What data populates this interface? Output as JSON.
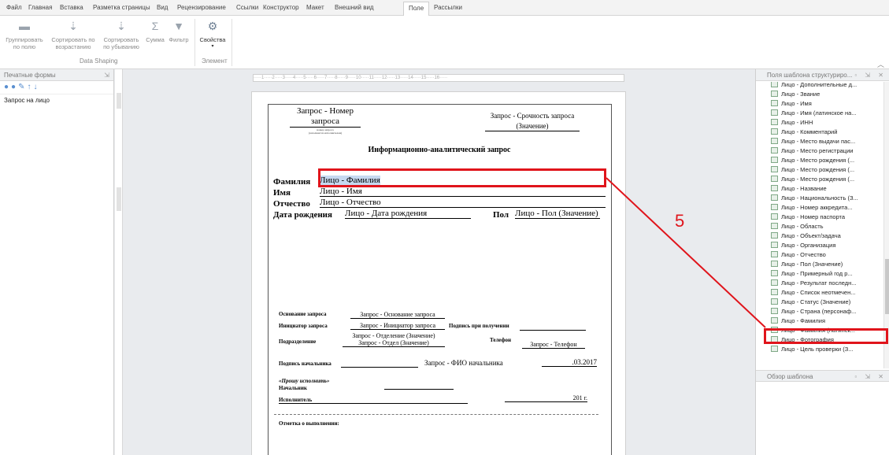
{
  "ribbon_tabs": [
    "Файл",
    "Главная",
    "Вставка",
    "Разметка страницы",
    "Вид",
    "Рецензирование",
    "Ссылки",
    "Конструктор",
    "Макет",
    "Внешний вид",
    "Поле",
    "Рассылки"
  ],
  "active_tab": "Поле",
  "ribbon": {
    "group_by_field": "Группировать\nпо полю",
    "sort_asc": "Сортировать по\nвозрастанию",
    "sort_desc": "Сортировать\nпо убыванию",
    "sum": "Сумма",
    "filter": "Фильтр",
    "properties": "Свойства",
    "group_data_shaping": "Data Shaping",
    "group_element": "Элемент"
  },
  "left_panel": {
    "title": "Печатные формы",
    "items": [
      "Запрос на лицо"
    ]
  },
  "right_panel": {
    "title": "Поля шаблона структуриро...",
    "bottom_title": "Обзор шаблона",
    "fields": [
      "Лицо - Дополнительные д...",
      "Лицо - Звание",
      "Лицо - Имя",
      "Лицо - Имя (латинское на...",
      "Лицо - ИНН",
      "Лицо - Комментарий",
      "Лицо - Место выдачи пас...",
      "Лицо - Место регистрации",
      "Лицо - Место рождения (...",
      "Лицо - Место рождения (...",
      "Лицо - Место рождения (...",
      "Лицо - Название",
      "Лицо - Национальность (З...",
      "Лицо - Номер аккредита...",
      "Лицо - Номер паспорта",
      "Лицо - Область",
      "Лицо - Объект/задача",
      "Лицо - Организация",
      "Лицо - Отчество",
      "Лицо - Пол (Значение)",
      "Лицо - Примерный год р...",
      "Лицо - Результат последн...",
      "Лицо - Список неотмечен...",
      "Лицо - Статус (Значение)",
      "Лицо - Страна (персонаф...",
      "Лицо - Фамилия",
      "Лицо - Фамилия (латинск...",
      "Лицо - Фотография",
      "Лицо - Цель проверки (З..."
    ]
  },
  "document": {
    "request_number": "Запрос - Номер\nзапроса",
    "number_caption": "номер запроса\n(заполняется исполнителем)",
    "urgency": "Запрос - Срочность запроса\n(Значение)",
    "heading": "Информационно-аналитический запрос",
    "surname_label": "Фамилия",
    "surname_value": "Лицо - Фамилия",
    "name_label": "Имя",
    "name_value": "Лицо - Имя",
    "patronymic_label": "Отчество",
    "patronymic_value": "Лицо - Отчество",
    "birthdate_label": "Дата рождения",
    "birthdate_value": "Лицо - Дата рождения",
    "sex_label": "Пол",
    "sex_value": "Лицо - Пол (Значение)",
    "basis_label": "Основание запроса",
    "basis_value": "Запрос - Основание запроса",
    "initiator_label": "Инициатор запроса",
    "initiator_value": "Запрос - Инициатор запроса",
    "receipt_signature_label": "Подпись при получении",
    "department_label": "Подразделение",
    "department_value": "Запрос - Отделение (Значение)\nЗапрос - Отдел (Значение)",
    "phone_label": "Телефон",
    "phone_value": "Запрос - Телефон",
    "chief_signature_label": "Подпись начальника",
    "chief_name_value": "Запрос - ФИО начальника",
    "date_value": ".03.2017",
    "execute_request": "«Прошу исполнить»",
    "chief_label": "Начальник",
    "executor_label": "Исполнитель",
    "year_value": "201   г.",
    "completion_mark_label": "Отметка о выполнении:"
  },
  "annotation": {
    "number": "5",
    "color": "#e0141b"
  },
  "colors": {
    "highlight": "#c6d9f0",
    "accent": "#5a8fd0"
  }
}
